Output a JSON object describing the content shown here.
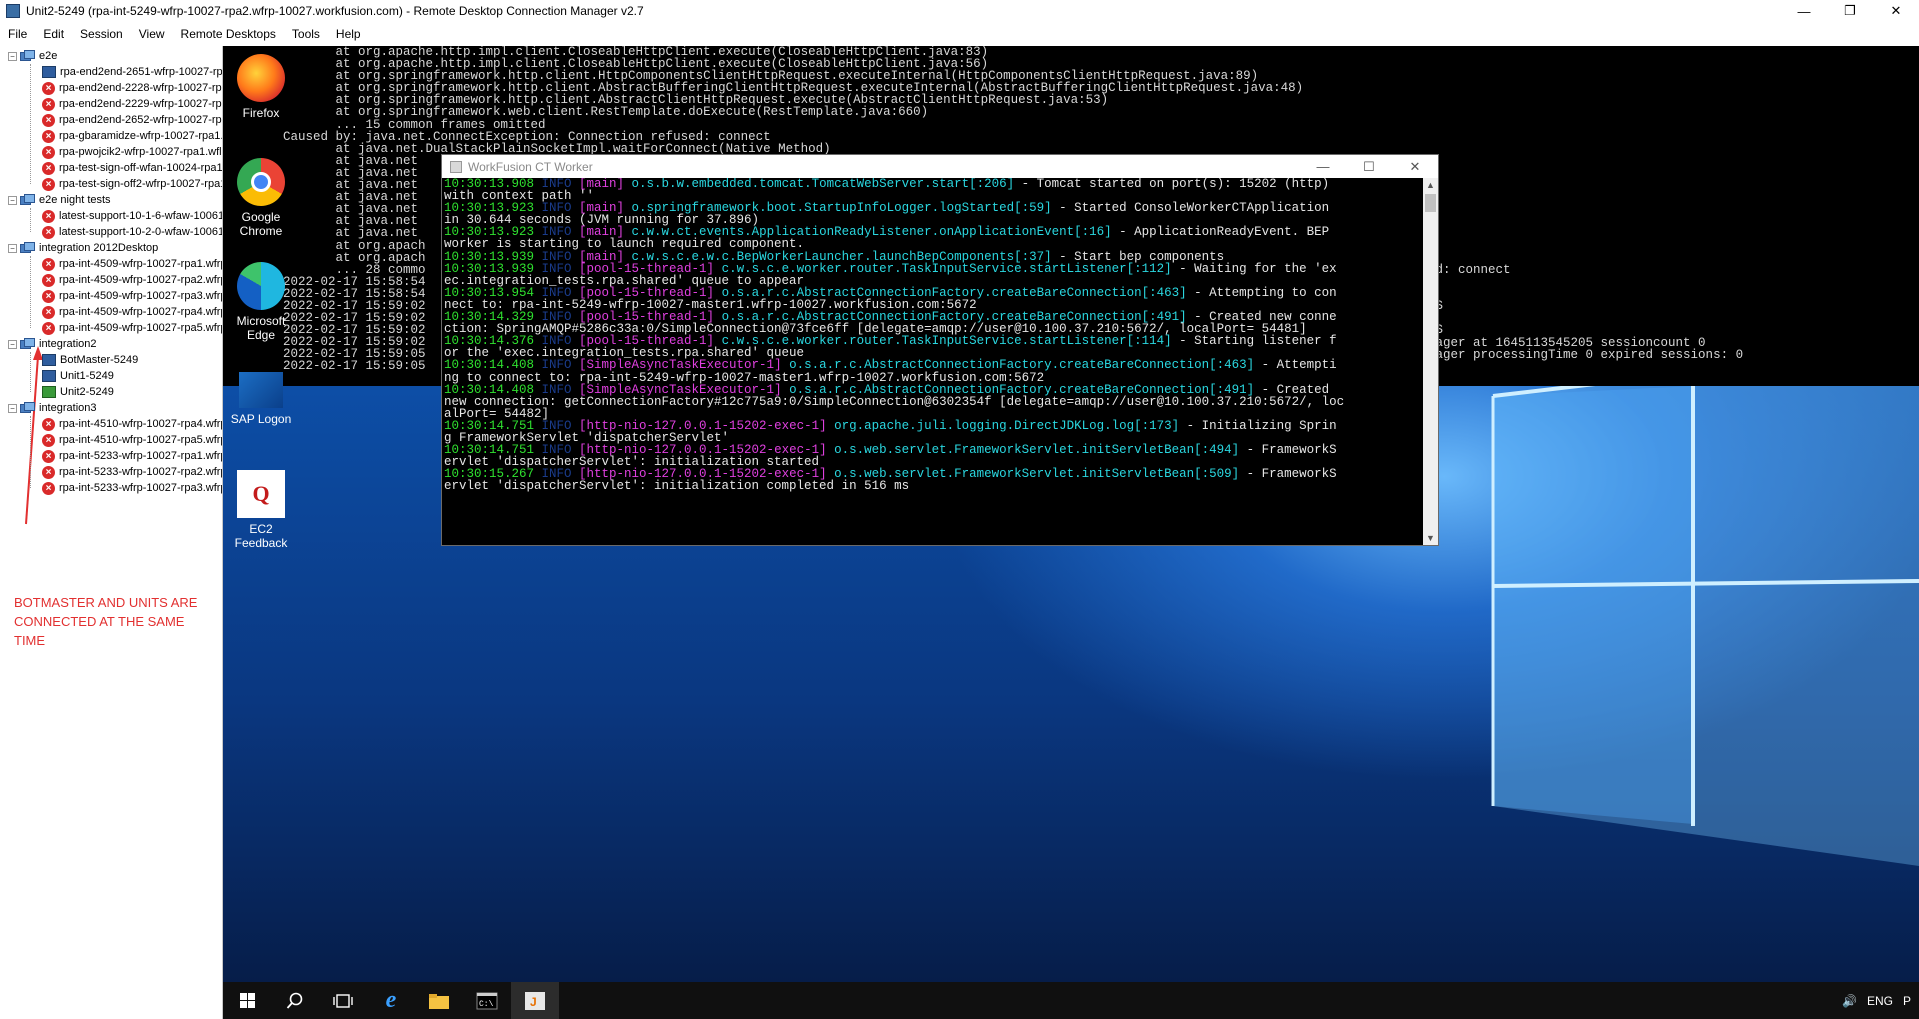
{
  "window": {
    "title": "Unit2-5249 (rpa-int-5249-wfrp-10027-rpa2.wfrp-10027.workfusion.com) - Remote Desktop Connection Manager v2.7",
    "minimize": "—",
    "maximize": "❐",
    "close": "✕"
  },
  "menu": [
    "File",
    "Edit",
    "Session",
    "View",
    "Remote Desktops",
    "Tools",
    "Help"
  ],
  "tree": {
    "groups": [
      {
        "label": "e2e",
        "items": [
          {
            "label": "rpa-end2end-2651-wfrp-10027-rpa",
            "status": "monitor"
          },
          {
            "label": "rpa-end2end-2228-wfrp-10027-rpa",
            "status": "error"
          },
          {
            "label": "rpa-end2end-2229-wfrp-10027-rpa",
            "status": "error"
          },
          {
            "label": "rpa-end2end-2652-wfrp-10027-rpa",
            "status": "error"
          },
          {
            "label": "rpa-gbaramidze-wfrp-10027-rpa1.w",
            "status": "error"
          },
          {
            "label": "rpa-pwojcik2-wfrp-10027-rpa1.wfl",
            "status": "error"
          },
          {
            "label": "rpa-test-sign-off-wfan-10024-rpa1.",
            "status": "error"
          },
          {
            "label": "rpa-test-sign-off2-wfrp-10027-rpa1",
            "status": "error"
          }
        ]
      },
      {
        "label": "e2e night tests",
        "items": [
          {
            "label": "latest-support-10-1-6-wfaw-10061",
            "status": "error"
          },
          {
            "label": "latest-support-10-2-0-wfaw-10061",
            "status": "error"
          }
        ]
      },
      {
        "label": "integration 2012Desktop",
        "items": [
          {
            "label": "rpa-int-4509-wfrp-10027-rpa1.wfrp",
            "status": "error"
          },
          {
            "label": "rpa-int-4509-wfrp-10027-rpa2.wfrp",
            "status": "error"
          },
          {
            "label": "rpa-int-4509-wfrp-10027-rpa3.wfrp",
            "status": "error"
          },
          {
            "label": "rpa-int-4509-wfrp-10027-rpa4.wfrp",
            "status": "error"
          },
          {
            "label": "rpa-int-4509-wfrp-10027-rpa5.wfrp",
            "status": "error"
          }
        ]
      },
      {
        "label": "integration2",
        "items": [
          {
            "label": "BotMaster-5249",
            "status": "monitor"
          },
          {
            "label": "Unit1-5249",
            "status": "monitor"
          },
          {
            "label": "Unit2-5249",
            "status": "monitor-green"
          }
        ]
      },
      {
        "label": "integration3",
        "items": [
          {
            "label": "rpa-int-4510-wfrp-10027-rpa4.wfrp",
            "status": "error"
          },
          {
            "label": "rpa-int-4510-wfrp-10027-rpa5.wfrp",
            "status": "error"
          },
          {
            "label": "rpa-int-5233-wfrp-10027-rpa1.wfrp",
            "status": "error"
          },
          {
            "label": "rpa-int-5233-wfrp-10027-rpa2.wfrp",
            "status": "error"
          },
          {
            "label": "rpa-int-5233-wfrp-10027-rpa3.wfrp",
            "status": "error"
          }
        ]
      }
    ]
  },
  "annotation": {
    "line1": "BOTMASTER AND UNITS ARE",
    "line2": "CONNECTED AT THE SAME",
    "line3": "TIME",
    "color": "#e23030"
  },
  "desktop": {
    "icons": [
      {
        "label": "Firefox",
        "icon": "firefox-icon"
      },
      {
        "label": "Google Chrome",
        "icon": "chrome-icon"
      },
      {
        "label": "Microsoft Edge",
        "icon": "edge-icon"
      },
      {
        "label": "SAP Logon",
        "icon": "sap-logon-icon"
      },
      {
        "label": "EC2 Feedback",
        "icon": "ec2-feedback-icon"
      }
    ]
  },
  "bg_console": {
    "lines": [
      "       at org.apache.http.impl.client.CloseableHttpClient.execute(CloseableHttpClient.java:83)",
      "       at org.apache.http.impl.client.CloseableHttpClient.execute(CloseableHttpClient.java:56)",
      "       at org.springframework.http.client.HttpComponentsClientHttpRequest.executeInternal(HttpComponentsClientHttpRequest.java:89)",
      "       at org.springframework.http.client.AbstractBufferingClientHttpRequest.executeInternal(AbstractBufferingClientHttpRequest.java:48)",
      "       at org.springframework.http.client.AbstractClientHttpRequest.execute(AbstractClientHttpRequest.java:53)",
      "       at org.springframework.web.client.RestTemplate.doExecute(RestTemplate.java:660)",
      "       ... 15 common frames omitted",
      "Caused by: java.net.ConnectException: Connection refused: connect",
      "       at java.net.DualStackPlainSocketImpl.waitForConnect(Native Method)",
      "       at java.net",
      "       at java.net",
      "       at java.net",
      "       at java.net",
      "       at java.net",
      "       at java.net",
      "       at java.net",
      "       at org.apach",
      "       at org.apach",
      "       ... 28 commo",
      "2022-02-17 15:58:54",
      "2022-02-17 15:58:54",
      "2022-02-17 15:59:02",
      "2022-02-17 15:59:02",
      "2022-02-17 15:59:02",
      "2022-02-17 15:59:02",
      "2022-02-17 15:59:05",
      "2022-02-17 15:59:05"
    ],
    "right_fragments": [
      "nnection refused: connect",
      "",
      "",
      "000 MILLISECONDS",
      "",
      "000 MILLISECONDS",
      "ons StandardManager at 1645113545205 sessioncount 0",
      "ons StandardManager processingTime 0 expired sessions: 0"
    ]
  },
  "ct_window": {
    "title": "WorkFusion CT Worker",
    "minimize": "—",
    "maximize": "☐",
    "close": "✕",
    "scroll_up": "▲",
    "scroll_down": "▼",
    "lines": [
      [
        {
          "cls": "g",
          "text": "10:30:13.908"
        },
        {
          "cls": "t",
          "text": " INFO "
        },
        {
          "cls": "m",
          "text": "[main]"
        },
        {
          "cls": "c",
          "text": " o.s.b.w.embedded.tomcat.TomcatWebServer.start[:206]"
        },
        {
          "cls": "",
          "text": " - Tomcat started on port(s): 15202 (http)"
        }
      ],
      [
        {
          "cls": "",
          "text": "with context path ''"
        }
      ],
      [
        {
          "cls": "g",
          "text": "10:30:13.923"
        },
        {
          "cls": "t",
          "text": " INFO "
        },
        {
          "cls": "m",
          "text": "[main]"
        },
        {
          "cls": "c",
          "text": " o.springframework.boot.StartupInfoLogger.logStarted[:59]"
        },
        {
          "cls": "",
          "text": " - Started ConsoleWorkerCTApplication"
        }
      ],
      [
        {
          "cls": "",
          "text": "in 30.644 seconds (JVM running for 37.896)"
        }
      ],
      [
        {
          "cls": "g",
          "text": "10:30:13.923"
        },
        {
          "cls": "t",
          "text": " INFO "
        },
        {
          "cls": "m",
          "text": "[main]"
        },
        {
          "cls": "c",
          "text": " c.w.w.ct.events.ApplicationReadyListener.onApplicationEvent[:16]"
        },
        {
          "cls": "",
          "text": " - ApplicationReadyEvent. BEP"
        }
      ],
      [
        {
          "cls": "",
          "text": "worker is starting to launch required component."
        }
      ],
      [
        {
          "cls": "g",
          "text": "10:30:13.939"
        },
        {
          "cls": "t",
          "text": " INFO "
        },
        {
          "cls": "m",
          "text": "[main]"
        },
        {
          "cls": "c",
          "text": " c.w.s.c.e.w.c.BepWorkerLauncher.launchBepComponents[:37]"
        },
        {
          "cls": "",
          "text": " - Start bep components"
        }
      ],
      [
        {
          "cls": "g",
          "text": "10:30:13.939"
        },
        {
          "cls": "t",
          "text": " INFO "
        },
        {
          "cls": "m",
          "text": "[pool-15-thread-1]"
        },
        {
          "cls": "c",
          "text": " c.w.s.c.e.worker.router.TaskInputService.startListener[:112]"
        },
        {
          "cls": "",
          "text": " - Waiting for the 'ex"
        }
      ],
      [
        {
          "cls": "",
          "text": "ec.integration_tests.rpa.shared' queue to appear"
        }
      ],
      [
        {
          "cls": "g",
          "text": "10:30:13.954"
        },
        {
          "cls": "t",
          "text": " INFO "
        },
        {
          "cls": "m",
          "text": "[pool-15-thread-1]"
        },
        {
          "cls": "c",
          "text": " o.s.a.r.c.AbstractConnectionFactory.createBareConnection[:463]"
        },
        {
          "cls": "",
          "text": " - Attempting to con"
        }
      ],
      [
        {
          "cls": "",
          "text": "nect to: rpa-int-5249-wfrp-10027-master1.wfrp-10027.workfusion.com:5672"
        }
      ],
      [
        {
          "cls": "g",
          "text": "10:30:14.329"
        },
        {
          "cls": "t",
          "text": " INFO "
        },
        {
          "cls": "m",
          "text": "[pool-15-thread-1]"
        },
        {
          "cls": "c",
          "text": " o.s.a.r.c.AbstractConnectionFactory.createBareConnection[:491]"
        },
        {
          "cls": "",
          "text": " - Created new conne"
        }
      ],
      [
        {
          "cls": "",
          "text": "ction: SpringAMQP#5286c33a:0/SimpleConnection@73fce6ff [delegate=amqp://user@10.100.37.210:5672/, localPort= 54481]"
        }
      ],
      [
        {
          "cls": "g",
          "text": "10:30:14.376"
        },
        {
          "cls": "t",
          "text": " INFO "
        },
        {
          "cls": "m",
          "text": "[pool-15-thread-1]"
        },
        {
          "cls": "c",
          "text": " c.w.s.c.e.worker.router.TaskInputService.startListener[:114]"
        },
        {
          "cls": "",
          "text": " - Starting listener f"
        }
      ],
      [
        {
          "cls": "",
          "text": "or the 'exec.integration_tests.rpa.shared' queue"
        }
      ],
      [
        {
          "cls": "g",
          "text": "10:30:14.408"
        },
        {
          "cls": "t",
          "text": " INFO "
        },
        {
          "cls": "m",
          "text": "[SimpleAsyncTaskExecutor-1]"
        },
        {
          "cls": "c",
          "text": " o.s.a.r.c.AbstractConnectionFactory.createBareConnection[:463]"
        },
        {
          "cls": "",
          "text": " - Attempti"
        }
      ],
      [
        {
          "cls": "",
          "text": "ng to connect to: rpa-int-5249-wfrp-10027-master1.wfrp-10027.workfusion.com:5672"
        }
      ],
      [
        {
          "cls": "g",
          "text": "10:30:14.408"
        },
        {
          "cls": "t",
          "text": " INFO "
        },
        {
          "cls": "m",
          "text": "[SimpleAsyncTaskExecutor-1]"
        },
        {
          "cls": "c",
          "text": " o.s.a.r.c.AbstractConnectionFactory.createBareConnection[:491]"
        },
        {
          "cls": "",
          "text": " - Created"
        }
      ],
      [
        {
          "cls": "",
          "text": "new connection: getConnectionFactory#12c775a9:0/SimpleConnection@6302354f [delegate=amqp://user@10.100.37.210:5672/, loc"
        }
      ],
      [
        {
          "cls": "",
          "text": "alPort= 54482]"
        }
      ],
      [
        {
          "cls": "g",
          "text": "10:30:14.751"
        },
        {
          "cls": "t",
          "text": " INFO "
        },
        {
          "cls": "m",
          "text": "[http-nio-127.0.0.1-15202-exec-1]"
        },
        {
          "cls": "c",
          "text": " org.apache.juli.logging.DirectJDKLog.log[:173]"
        },
        {
          "cls": "",
          "text": " - Initializing Sprin"
        }
      ],
      [
        {
          "cls": "",
          "text": "g FrameworkServlet 'dispatcherServlet'"
        }
      ],
      [
        {
          "cls": "g",
          "text": "10:30:14.751"
        },
        {
          "cls": "t",
          "text": " INFO "
        },
        {
          "cls": "m",
          "text": "[http-nio-127.0.0.1-15202-exec-1]"
        },
        {
          "cls": "c",
          "text": " o.s.web.servlet.FrameworkServlet.initServletBean[:494]"
        },
        {
          "cls": "",
          "text": " - FrameworkS"
        }
      ],
      [
        {
          "cls": "",
          "text": "ervlet 'dispatcherServlet': initialization started"
        }
      ],
      [
        {
          "cls": "g",
          "text": "10:30:15.267"
        },
        {
          "cls": "t",
          "text": " INFO "
        },
        {
          "cls": "m",
          "text": "[http-nio-127.0.0.1-15202-exec-1]"
        },
        {
          "cls": "c",
          "text": " o.s.web.servlet.FrameworkServlet.initServletBean[:509]"
        },
        {
          "cls": "",
          "text": " - FrameworkS"
        }
      ],
      [
        {
          "cls": "",
          "text": "ervlet 'dispatcherServlet': initialization completed in 516 ms"
        }
      ]
    ]
  },
  "taskbar": {
    "items": [
      "start-button",
      "search-icon",
      "task-view-icon",
      "ie-icon",
      "file-explorer-icon",
      "cmd-icon",
      "java-icon"
    ],
    "tray": {
      "volume": "🔊",
      "language": "ENG",
      "input": "P"
    }
  }
}
